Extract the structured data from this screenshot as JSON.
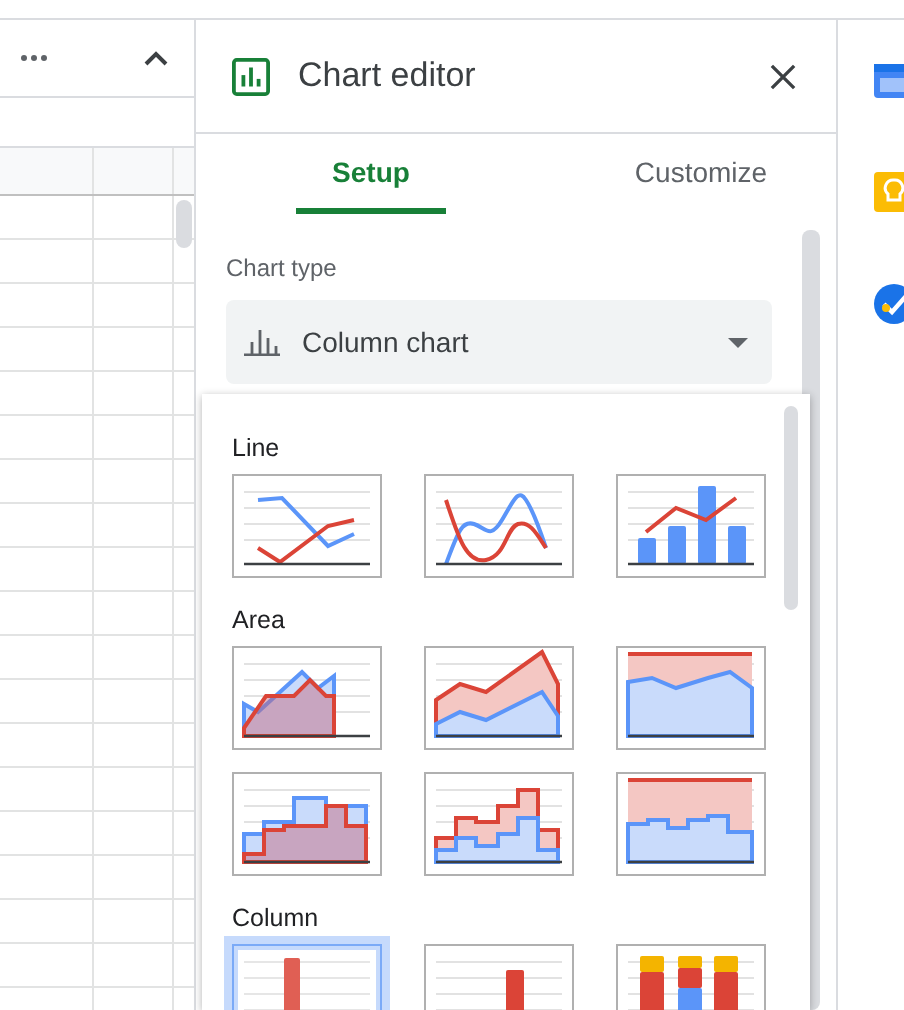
{
  "header": {
    "title": "Chart editor"
  },
  "tabs": [
    {
      "label": "Setup",
      "selected": true
    },
    {
      "label": "Customize",
      "selected": false
    }
  ],
  "chart_type": {
    "label": "Chart type",
    "value": "Column chart"
  },
  "sections": [
    {
      "title": "Line",
      "items": [
        {
          "kind": "line",
          "selected": false
        },
        {
          "kind": "smooth-line",
          "selected": false
        },
        {
          "kind": "combo",
          "selected": false
        }
      ]
    },
    {
      "title": "Area",
      "items": [
        {
          "kind": "area",
          "selected": false
        },
        {
          "kind": "stacked-area",
          "selected": false
        },
        {
          "kind": "percent-area",
          "selected": false
        },
        {
          "kind": "stepped-area",
          "selected": false
        },
        {
          "kind": "stacked-stepped-area",
          "selected": false
        },
        {
          "kind": "percent-stepped-area",
          "selected": false
        }
      ]
    },
    {
      "title": "Column",
      "items": [
        {
          "kind": "column",
          "selected": true
        },
        {
          "kind": "stacked-column",
          "selected": false
        },
        {
          "kind": "percent-column",
          "selected": false
        }
      ]
    }
  ]
}
